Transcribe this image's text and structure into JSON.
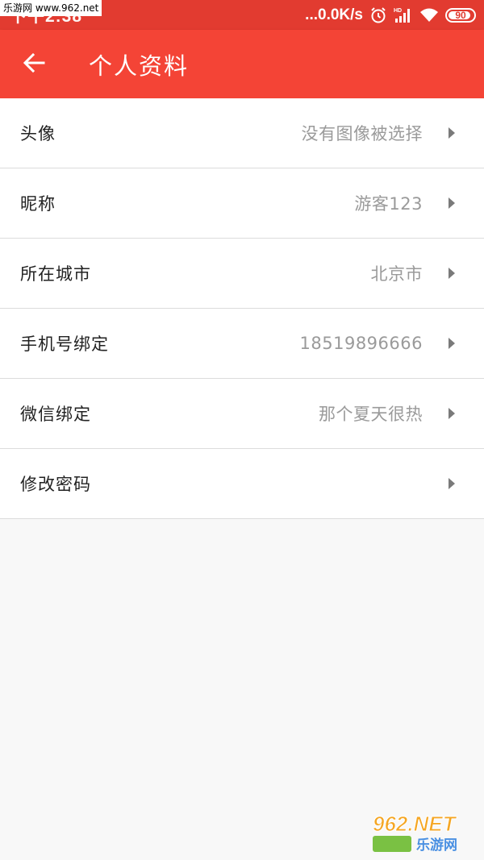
{
  "watermark": {
    "text": "乐游网 www.962.net"
  },
  "status_bar": {
    "time": "下午2:38",
    "net_speed": "...0.0K/s",
    "battery": "90",
    "icons": [
      "alarm-icon",
      "hd-signal-icon",
      "wifi-icon",
      "battery-icon"
    ]
  },
  "toolbar": {
    "title": "个人资料",
    "back_icon": "arrow-left-icon"
  },
  "rows": [
    {
      "label": "头像",
      "value": "没有图像被选择"
    },
    {
      "label": "昵称",
      "value": "游客123"
    },
    {
      "label": "所在城市",
      "value": "北京市"
    },
    {
      "label": "手机号绑定",
      "value": "18519896666"
    },
    {
      "label": "微信绑定",
      "value": "那个夏天很热"
    },
    {
      "label": "修改密码",
      "value": ""
    }
  ],
  "logo": {
    "main": "962.NET",
    "sub": "乐游网"
  },
  "colors": {
    "toolbar": "#f44436",
    "status_bar": "#e23b30",
    "background": "#f8f8f8",
    "value_text": "#9a9a9a"
  }
}
